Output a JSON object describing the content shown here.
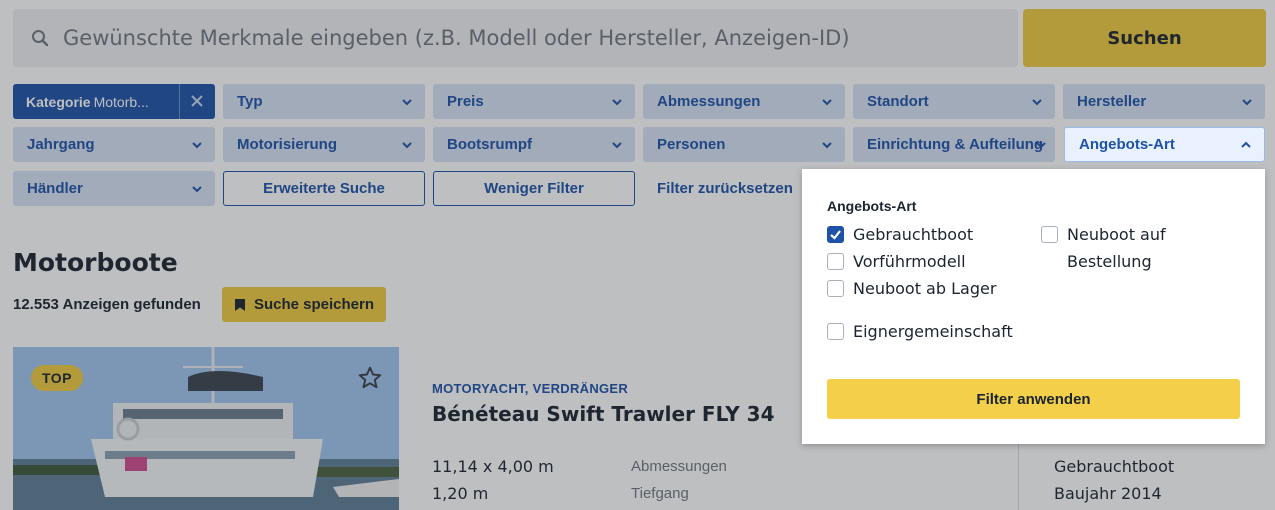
{
  "search": {
    "placeholder": "Gewünschte Merkmale eingeben (z.B. Modell oder Hersteller, Anzeigen-ID)",
    "button_label": "Suchen"
  },
  "filters": {
    "category": {
      "label": "Kategorie",
      "value": "Motorb..."
    },
    "chips_row1": [
      "Typ",
      "Preis",
      "Abmessungen",
      "Standort",
      "Hersteller"
    ],
    "chips_row2": [
      "Jahrgang",
      "Motorisierung",
      "Bootsrumpf",
      "Personen",
      "Einrichtung & Aufteilung",
      "Angebots-Art"
    ],
    "dealer_chip": "Händler",
    "advanced_search": "Erweiterte Suche",
    "fewer_filters": "Weniger Filter",
    "reset_filters": "Filter zurücksetzen"
  },
  "results": {
    "title": "Motorboote",
    "count": "12.553 Anzeigen gefunden",
    "save_search": "Suche speichern"
  },
  "listing": {
    "badge": "TOP",
    "category": "MOTORYACHT, VERDRÄNGER",
    "title": "Bénéteau Swift Trawler FLY 34",
    "dimensions_value": "11,14 x 4,00 m",
    "dimensions_label": "Abmessungen",
    "draft_value": "1,20 m",
    "draft_label": "Tiefgang",
    "condition": "Gebrauchtboot",
    "year": "Baujahr 2014"
  },
  "dropdown": {
    "title": "Angebots-Art",
    "options": [
      {
        "label": "Gebrauchtboot",
        "checked": true
      },
      {
        "label": "Vorführmodell",
        "checked": false
      },
      {
        "label": "Neuboot ab Lager",
        "checked": false
      },
      {
        "label": "Neuboot auf",
        "label2": "Bestellung",
        "checked": false
      },
      {
        "label": "Eignergemeinschaft",
        "checked": false
      }
    ],
    "apply_label": "Filter anwenden"
  },
  "colors": {
    "accent_blue": "#1d52a8",
    "chip_bg": "#d7e3f5",
    "yellow": "#f0ca3e"
  }
}
